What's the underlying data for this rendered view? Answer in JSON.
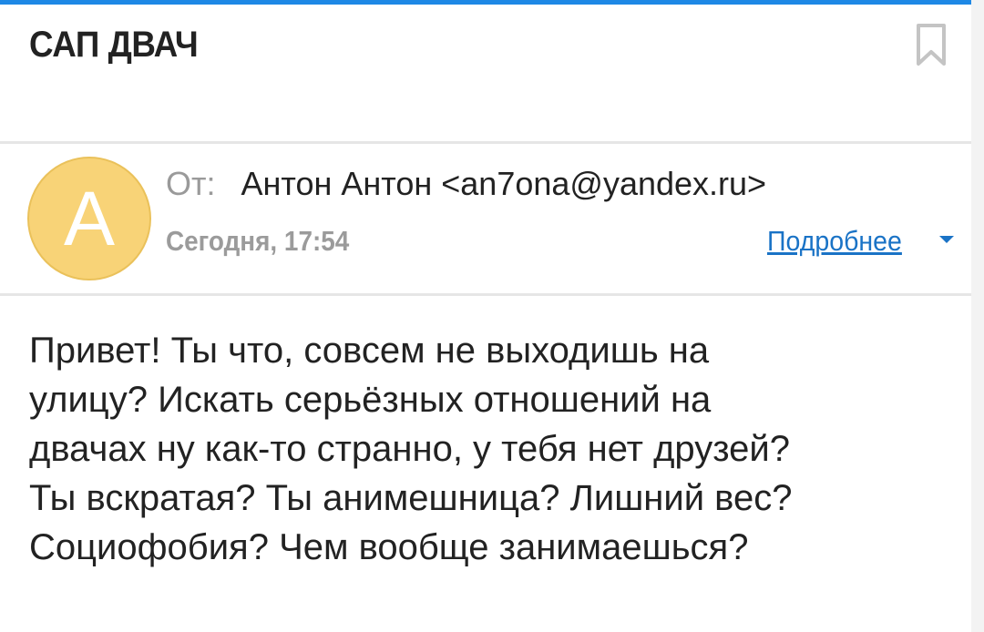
{
  "colors": {
    "accent": "#1e88e5",
    "avatar_bg": "#f8d377",
    "link": "#1a73c6"
  },
  "header": {
    "subject": "САП ДВАЧ",
    "bookmark_icon": "bookmark-icon"
  },
  "message": {
    "avatar_letter": "А",
    "from_label": "От:",
    "from_value": "Антон Антон <an7ona@yandex.ru>",
    "date": "Сегодня, 17:54",
    "details_link": "Подробнее",
    "details_icon": "chevron-down-icon",
    "body_lines": [
      "Привет! Ты что, совсем не выходишь на",
      "улицу? Искать серьёзных отношений на",
      "двачах ну как-то странно, у тебя нет друзей?",
      "Ты вскратая? Ты анимешница? Лишний вес?",
      "Социофобия? Чем вообще занимаешься?"
    ]
  }
}
